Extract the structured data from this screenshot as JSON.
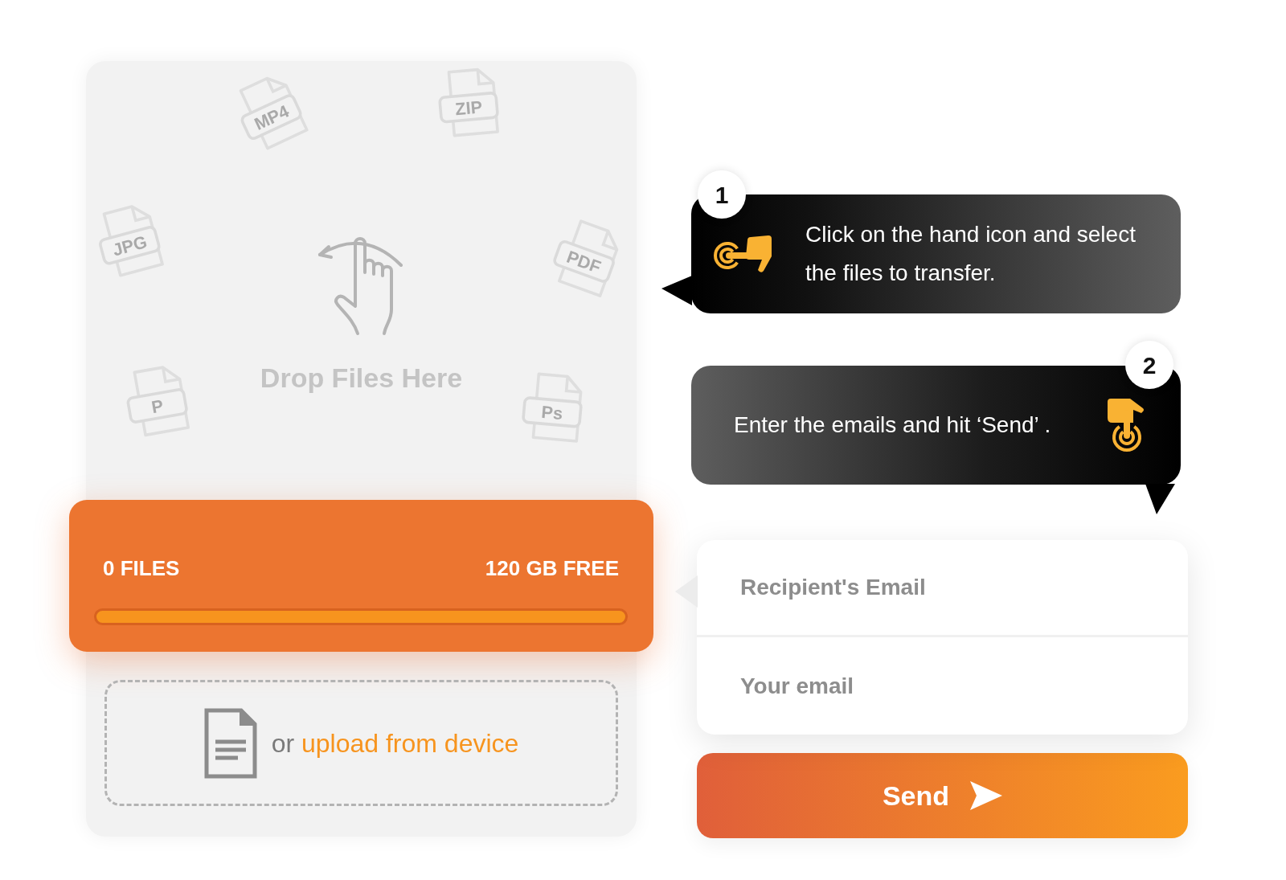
{
  "drop_zone": {
    "file_type_icons": [
      "MP4",
      "ZIP",
      "JPG",
      "PDF",
      "P",
      "Ps"
    ],
    "title": "Drop Files Here"
  },
  "status_bar": {
    "files": "0 FILES",
    "free": "120 GB FREE",
    "level": 1
  },
  "upload": {
    "prefix": "or",
    "link": "upload from device"
  },
  "steps": [
    {
      "number": "1",
      "kind": "left",
      "text": "Click on the hand icon and select the files to transfer."
    },
    {
      "number": "2",
      "kind": "right",
      "text": "Enter the emails and hit ‘Send’ ."
    }
  ],
  "form": {
    "fields": [
      {
        "placeholder": "Recipient's Email"
      },
      {
        "placeholder": "Your email"
      }
    ],
    "button": "Send"
  }
}
